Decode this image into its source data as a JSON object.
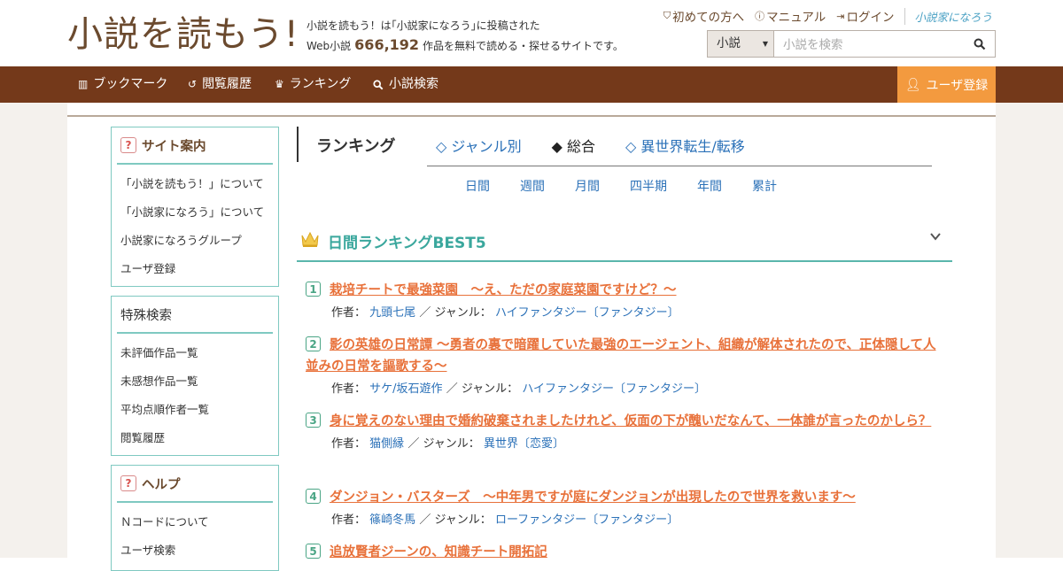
{
  "header": {
    "logo_text": "小説を読もう!",
    "tagline_line1": "小説を読もう！は｢小説家になろう｣に投稿された",
    "tagline_prefix": "Web小説",
    "tagline_count": "666,192",
    "tagline_suffix": "作品を無料で読める・探せるサイトです。",
    "links": [
      "初めての方へ",
      "マニュアル",
      "ログイン"
    ],
    "narou_logo": "小説家になろう",
    "search": {
      "select_value": "小説",
      "placeholder": "小説を検索"
    }
  },
  "nav": {
    "items": [
      "ブックマーク",
      "閲覧履歴",
      "ランキング",
      "小説検索"
    ],
    "register": "ユーザ登録"
  },
  "sidebar": {
    "site_guide": {
      "title": "サイト案内",
      "items": [
        "「小説を読もう！」について",
        "「小説家になろう」について",
        "小説家になろうグループ",
        "ユーザ登録"
      ]
    },
    "special_search": {
      "title": "特殊検索",
      "items": [
        "未評価作品一覧",
        "未感想作品一覧",
        "平均点順作者一覧",
        "閲覧履歴"
      ]
    },
    "help": {
      "title": "ヘルプ",
      "items": [
        "Ｎコードについて",
        "ユーザ検索"
      ]
    }
  },
  "ranking": {
    "title": "ランキング",
    "tabs": [
      "◇ ジャンル別",
      "◆ 総合",
      "◇ 異世界転生/転移"
    ],
    "periods": [
      "日間",
      "週間",
      "月間",
      "四半期",
      "年間",
      "累計"
    ],
    "best_title": "日間ランキングBEST5",
    "author_label": "作者：",
    "genre_label": "／ ジャンル：",
    "entries": [
      {
        "rank": "1",
        "title": "栽培チートで最強菜園　～え、ただの家庭菜園ですけど？～",
        "author": "九頭七尾",
        "genre": "ハイファンタジー〔ファンタジー〕"
      },
      {
        "rank": "2",
        "title": "影の英雄の日常譚 ～勇者の裏で暗躍していた最強のエージェント、組織が解体されたので、正体隠して人並みの日常を謳歌する～",
        "author": "サケ/坂石遊作",
        "genre": "ハイファンタジー〔ファンタジー〕"
      },
      {
        "rank": "3",
        "title": "身に覚えのない理由で婚約破棄されましたけれど、仮面の下が醜いだなんて、一体誰が言ったのかしら？",
        "author": "猫側縁",
        "genre": "異世界〔恋愛〕"
      },
      {
        "rank": "4",
        "title": "ダンジョン・バスターズ　～中年男ですが庭にダンジョンが出現したので世界を救います～",
        "author": "篠崎冬馬",
        "genre": "ローファンタジー〔ファンタジー〕"
      },
      {
        "rank": "5",
        "title": "追放賢者ジーンの、知識チート開拓記",
        "author": "",
        "genre": ""
      }
    ]
  },
  "colors": {
    "brand_brown": "#74391a",
    "register_orange": "#f39a3f",
    "teal": "#5ab6ac",
    "link_blue": "#2b71b8",
    "title_orange": "#e8713a"
  }
}
